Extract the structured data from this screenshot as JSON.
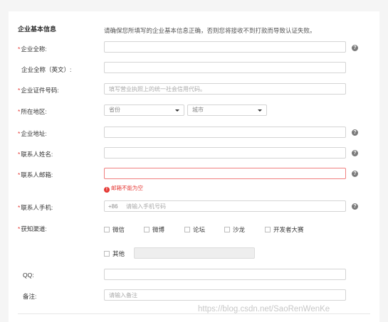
{
  "section": {
    "title": "企业基本信息",
    "hint": "请确保您所填写的企业基本信息正确，否则您将接收不到打款而导致认证失败。"
  },
  "fields": {
    "company_name": {
      "label": "企业全称:",
      "required": true,
      "value": ""
    },
    "company_name_en": {
      "label": "企业全称（英文）:",
      "required": false,
      "value": ""
    },
    "license_no": {
      "label": "企业证件号码:",
      "required": true,
      "placeholder": "填写营业执照上的统一社会信用代码。"
    },
    "region": {
      "label": "所在地区:",
      "required": true,
      "province": "省份",
      "city": "城市"
    },
    "address": {
      "label": "企业地址:",
      "required": true,
      "value": ""
    },
    "contact_name": {
      "label": "联系人姓名:",
      "required": true,
      "value": ""
    },
    "contact_email": {
      "label": "联系人邮箱:",
      "required": true,
      "value": "",
      "error": "邮箱不能为空"
    },
    "contact_phone": {
      "label": "联系人手机:",
      "required": true,
      "prefix": "+86",
      "placeholder": "请输入手机号码"
    },
    "channel": {
      "label": "获知渠道:",
      "required": true,
      "options": [
        "微信",
        "微博",
        "论坛",
        "沙龙",
        "开发者大赛"
      ],
      "other_label": "其他"
    },
    "qq": {
      "label": "QQ:",
      "required": false,
      "value": ""
    },
    "remark": {
      "label": "备注:",
      "required": false,
      "placeholder": "请输入备注"
    }
  },
  "help_icon_glyph": "?",
  "error_icon_glyph": "!",
  "required_mark": "*",
  "watermark": "https://blog.csdn.net/SaoRenWenKe",
  "colors": {
    "required": "#e53935",
    "error_border": "#f08080",
    "background": "#f5f5f5"
  },
  "icons": [
    "help-icon",
    "error-icon",
    "chevron-down-icon"
  ]
}
